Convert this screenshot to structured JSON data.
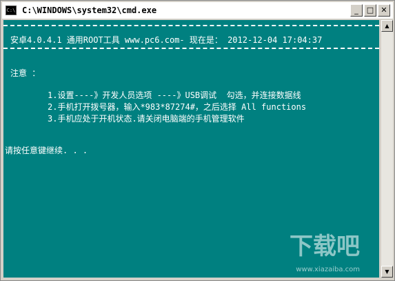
{
  "window": {
    "title": "C:\\WINDOWS\\system32\\cmd.exe",
    "icon_label": "C:\\",
    "buttons": {
      "minimize": "_",
      "maximize": "□",
      "close": "✕"
    }
  },
  "console": {
    "header": "安卓4.0.4.1 通用ROOT工具 www.pc6.com- 现在是： 2012-12-04 17:04:37",
    "notice_label": "注意 ：",
    "steps": [
      "1.设置----》开发人员选项 ----》USB调试  勾选，并连接数据线",
      "2.手机打开拨号器，输入*983*87274#，之后选择 All functions",
      "3.手机应处于开机状态.请关闭电脑端的手机管理软件"
    ],
    "prompt": "请按任意键继续. . ."
  },
  "scrollbar": {
    "up_icon": "▲",
    "down_icon": "▼"
  },
  "watermark": {
    "text": "下载吧",
    "url": "www.xiazaiba.com"
  },
  "colors": {
    "console_bg": "#008080",
    "console_fg": "#ffffff"
  }
}
